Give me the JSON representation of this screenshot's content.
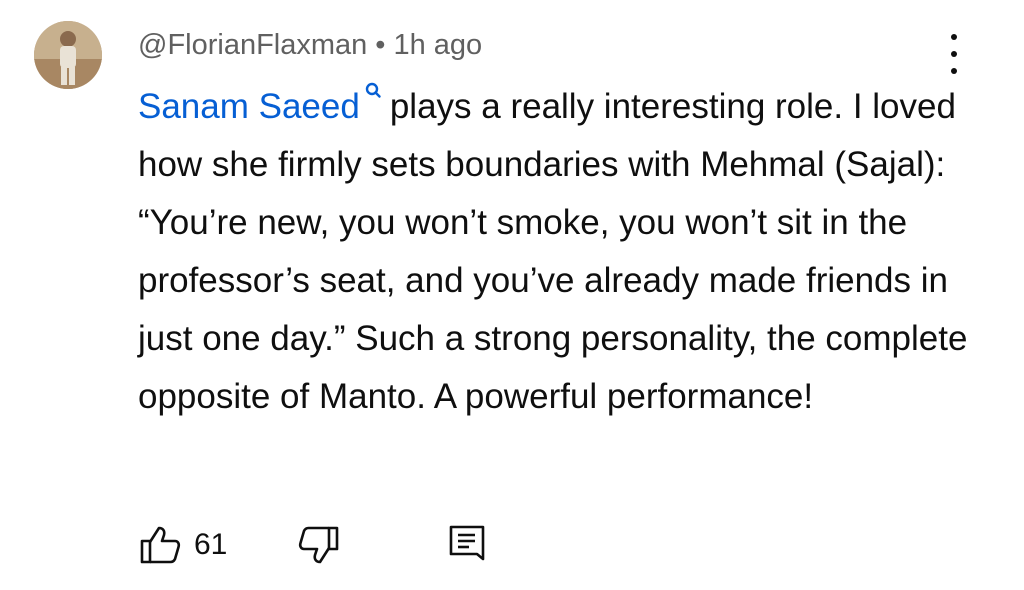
{
  "comment": {
    "author": "@FlorianFlaxman",
    "separator": "•",
    "time": "1h ago",
    "mention": "Sanam Saeed",
    "text": "plays a really interesting role. I loved how she firmly sets boundaries with Mehmal (Sajal): “You’re new, you won’t smoke, you won’t sit in the professor’s seat, and you’ve already made friends in just one day.” Such a strong personality, the complete opposite of Manto. A powerful performance!",
    "like_count": "61"
  },
  "icons": {
    "avatar": "user-avatar",
    "menu": "more-vert-icon",
    "mention": "search-icon",
    "like": "thumbs-up-icon",
    "dislike": "thumbs-down-icon",
    "reply": "comment-reply-icon"
  },
  "colors": {
    "mention": "#065fd4",
    "text": "#0f0f0f",
    "meta": "#606060"
  }
}
